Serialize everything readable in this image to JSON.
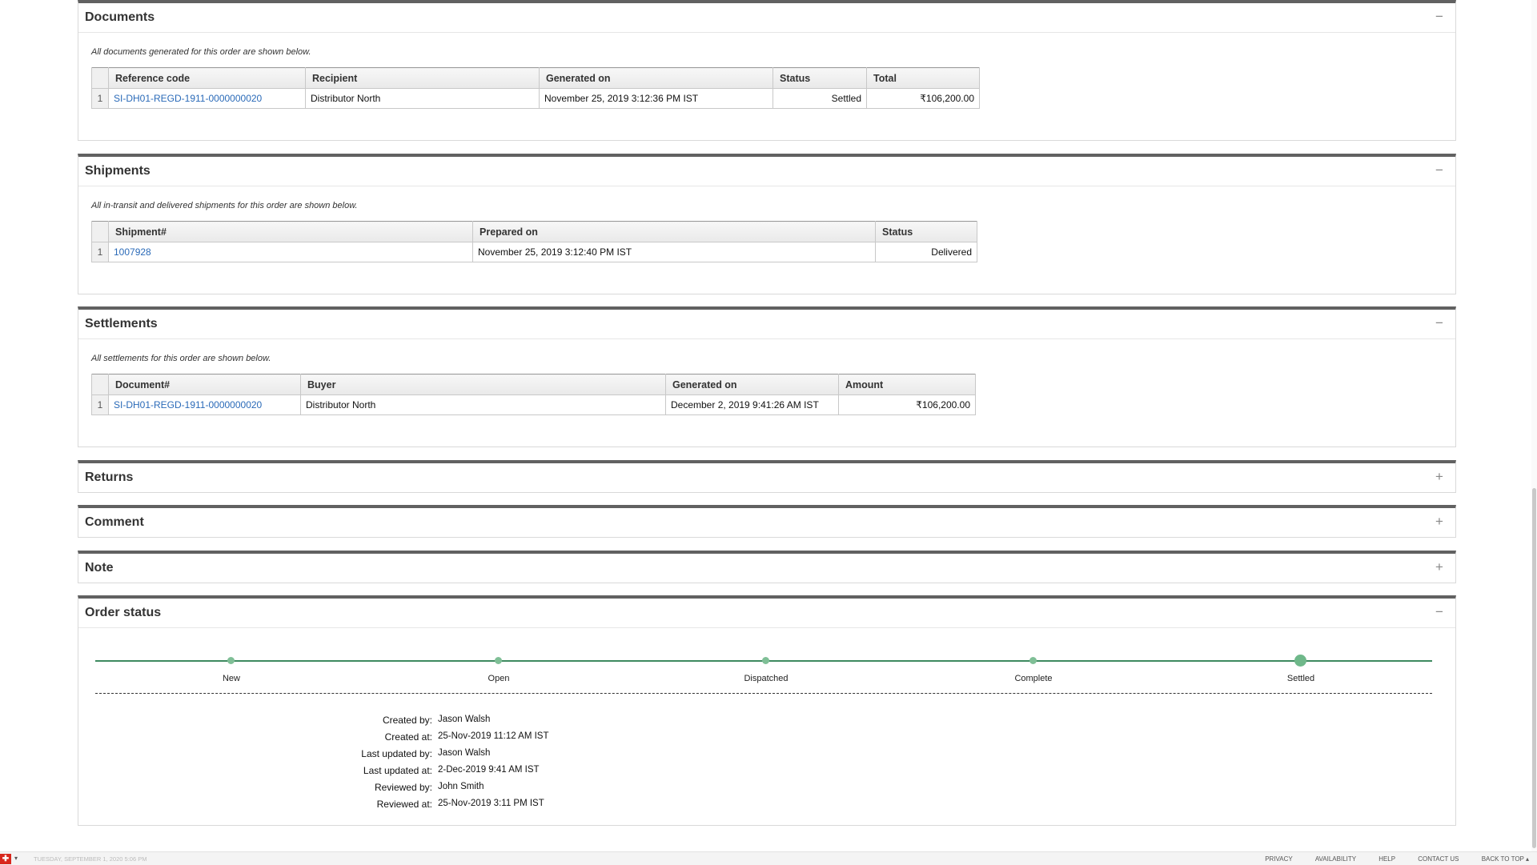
{
  "documents": {
    "title": "Documents",
    "toggle": "−",
    "description": "All documents generated for this order are shown below.",
    "columns": [
      "Reference code",
      "Recipient",
      "Generated on",
      "Status",
      "Total"
    ],
    "rows": [
      {
        "n": "1",
        "ref": "SI-DH01-REGD-1911-0000000020",
        "recipient": "Distributor North",
        "generated": "November 25, 2019 3:12:36 PM IST",
        "status": "Settled",
        "total": "₹106,200.00"
      }
    ]
  },
  "shipments": {
    "title": "Shipments",
    "toggle": "−",
    "description": "All in-transit and delivered shipments for this order are shown below.",
    "columns": [
      "Shipment#",
      "Prepared on",
      "Status"
    ],
    "rows": [
      {
        "n": "1",
        "shipment": "1007928",
        "prepared": "November 25, 2019 3:12:40 PM IST",
        "status": "Delivered"
      }
    ]
  },
  "settlements": {
    "title": "Settlements",
    "toggle": "−",
    "description": "All settlements for this order are shown below.",
    "columns": [
      "Document#",
      "Buyer",
      "Generated on",
      "Amount"
    ],
    "rows": [
      {
        "n": "1",
        "document": "SI-DH01-REGD-1911-0000000020",
        "buyer": "Distributor North",
        "generated": "December 2, 2019 9:41:26 AM IST",
        "amount": "₹106,200.00"
      }
    ]
  },
  "returns": {
    "title": "Returns",
    "toggle": "+"
  },
  "comment": {
    "title": "Comment",
    "toggle": "+"
  },
  "note": {
    "title": "Note",
    "toggle": "+"
  },
  "order_status": {
    "title": "Order status",
    "toggle": "−",
    "steps": [
      "New",
      "Open",
      "Dispatched",
      "Complete",
      "Settled"
    ],
    "current_step": "Settled",
    "meta": {
      "created_by_label": "Created by:",
      "created_by": "Jason Walsh",
      "created_at_label": "Created at:",
      "created_at": "25-Nov-2019 11:12 AM IST",
      "updated_by_label": "Last updated by:",
      "updated_by": "Jason Walsh",
      "updated_at_label": "Last updated at:",
      "updated_at": "2-Dec-2019 9:41 AM IST",
      "reviewed_by_label": "Reviewed by:",
      "reviewed_by": "John Smith",
      "reviewed_at_label": "Reviewed at:",
      "reviewed_at": "25-Nov-2019 3:11 PM IST"
    }
  },
  "footer": {
    "date": "TUESDAY, SEPTEMBER 1, 2020 5:06 PM",
    "links": [
      "PRIVACY",
      "AVAILABILITY",
      "HELP",
      "CONTACT US",
      "BACK TO TOP ▴"
    ]
  },
  "colors": {
    "accent": "#2a6ab8",
    "panel_border": "#616161",
    "timeline": "#3d8a60"
  }
}
